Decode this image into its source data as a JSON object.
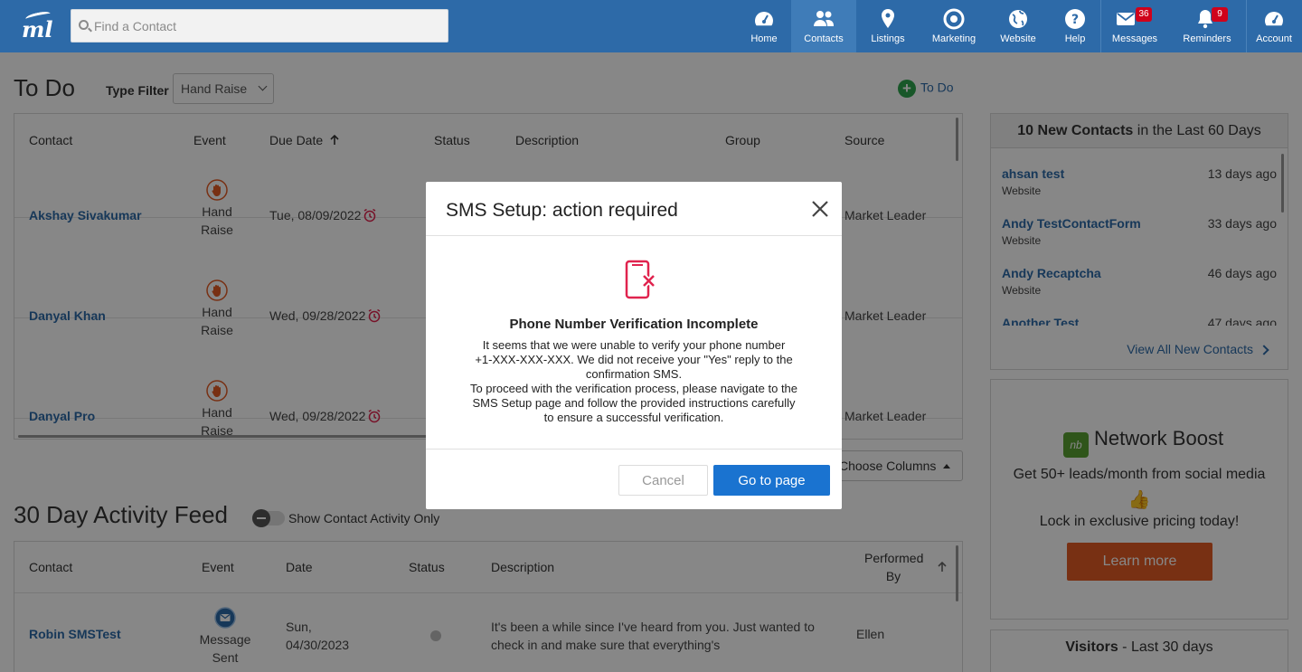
{
  "nav": {
    "logo_text": "ml",
    "search_placeholder": "Find a Contact",
    "items": [
      {
        "label": "Home",
        "icon": "dashboard-gauge-icon"
      },
      {
        "label": "Contacts",
        "icon": "people-icon"
      },
      {
        "label": "Listings",
        "icon": "map-pin-icon"
      },
      {
        "label": "Marketing",
        "icon": "target-icon"
      },
      {
        "label": "Website",
        "icon": "globe-icon"
      },
      {
        "label": "Help",
        "icon": "question-circle-icon"
      },
      {
        "label": "Messages",
        "icon": "envelope-icon",
        "badge": "36"
      },
      {
        "label": "Reminders",
        "icon": "bell-icon",
        "badge": "9"
      },
      {
        "label": "Account",
        "icon": "dashboard-gauge-icon"
      }
    ],
    "active": "Contacts"
  },
  "todo": {
    "title": "To Do",
    "type_filter_label": "Type Filter",
    "type_filter_value": "Hand Raise",
    "add_label": "To Do",
    "columns": [
      "Contact",
      "Event",
      "Due Date",
      "Status",
      "Description",
      "Group",
      "Source"
    ],
    "rows": [
      {
        "contact": "Akshay Sivakumar",
        "event": [
          "Hand",
          "Raise"
        ],
        "due": "Tue, 08/09/2022",
        "source": "Market Leader"
      },
      {
        "contact": "Danyal Khan",
        "event": [
          "Hand",
          "Raise"
        ],
        "due": "Wed, 09/28/2022",
        "source": "Market Leader"
      },
      {
        "contact": "Danyal Pro",
        "event": [
          "Hand",
          "Raise"
        ],
        "due": "Wed, 09/28/2022",
        "source": "Market Leader"
      }
    ],
    "choose_columns": "Choose Columns"
  },
  "feed": {
    "title": "30 Day Activity Feed",
    "toggle_label": "Show Contact Activity Only",
    "columns": [
      "Contact",
      "Event",
      "Date",
      "Status",
      "Description",
      "Performed",
      "By"
    ],
    "rows": [
      {
        "contact": "Robin SMSTest",
        "event": [
          "Message",
          "Sent"
        ],
        "date": [
          "Sun,",
          "04/30/2023"
        ],
        "description": [
          "It's been a while since I've heard from you. Just wanted to",
          "check in and make sure that everything's"
        ],
        "performed_by": "Ellen"
      }
    ]
  },
  "new_contacts": {
    "count": "10 New Contacts",
    "suffix": " in the Last 60 Days",
    "items": [
      {
        "name": "ahsan test",
        "source": "Website",
        "when": "13 days ago"
      },
      {
        "name": "Andy TestContactForm",
        "source": "Website",
        "when": "33 days ago"
      },
      {
        "name": "Andy Recaptcha",
        "source": "Website",
        "when": "46 days ago"
      },
      {
        "name": "Another Test",
        "source": "",
        "when": "47 days ago"
      }
    ],
    "view_all": "View All New Contacts"
  },
  "network_boost": {
    "brand": "Network Boost",
    "brand_mark": "nb",
    "line1": "Get 50+ leads/month from social media",
    "line2": "Lock in exclusive pricing today!",
    "cta": "Learn more"
  },
  "visitors": {
    "title_bold": "Visitors",
    "title_rest": " - Last 30 days"
  },
  "modal": {
    "title": "SMS Setup: action required",
    "heading": "Phone Number Verification Incomplete",
    "body_lines": [
      "It seems that we were unable to verify your phone number",
      "+1-XXX-XXX-XXX. We did not receive your \"Yes\" reply to the",
      "confirmation SMS.",
      "To proceed with the verification process, please navigate to the",
      "SMS Setup page and follow the provided instructions carefully",
      "to ensure a successful verification."
    ],
    "cancel": "Cancel",
    "go": "Go to page"
  },
  "colors": {
    "nav_bg": "#2d6aa8",
    "link": "#2d6aa8",
    "primary_button": "#1a73d0",
    "cta_orange": "#e35b25",
    "alert_red": "#e0234e",
    "add_green": "#2ea44f"
  }
}
